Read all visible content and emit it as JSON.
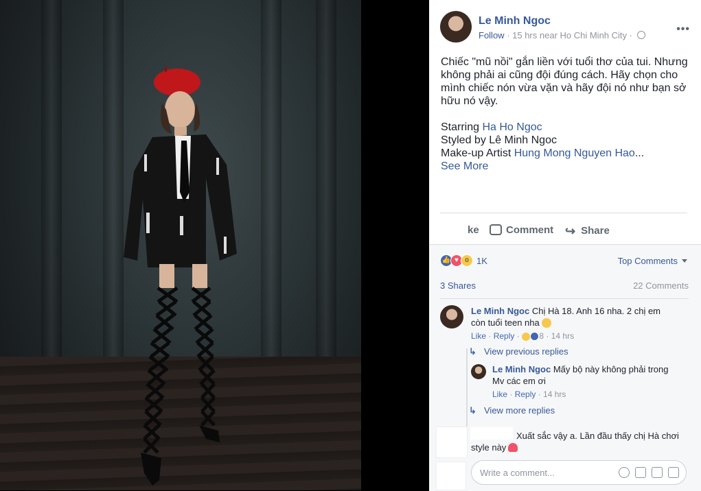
{
  "post": {
    "author": "Le Minh Ngoc",
    "follow_label": "Follow",
    "meta": " · 15 hrs near Ho Chi Minh City · ",
    "more_label": "•••",
    "text_line1": "Chiếc \"mũ nồi\" gắn liền với tuổi thơ của tui. Nhưng không phải ai cũng đội đúng cách. Hãy chọn cho mình chiếc nón vừa vặn và hãy đội nó như bạn sở hữu nó vậy.",
    "starring_prefix": "Starring ",
    "starring_name": "Ha Ho Ngoc",
    "styled_by": "Styled by Lê Minh Ngoc",
    "makeup_prefix": "Make-up Artist ",
    "makeup_name": "Hung Mong Nguyen Hao",
    "ellipsis": "...",
    "see_more": "See More"
  },
  "actions": {
    "like_partial": "ke",
    "comment_label": "Comment",
    "share_label": "Share"
  },
  "reactions": {
    "count": "1K",
    "top_comments": "Top Comments",
    "shares": "3 Shares",
    "comments": "22 Comments"
  },
  "comments": [
    {
      "author": "Le Minh Ngoc",
      "text": " Chị Hà 18. Anh 16 nha. 2 chị em còn tuổi teen nha",
      "like": "Like",
      "reply": "Reply",
      "reactions_count": "8",
      "time": "14 hrs"
    },
    {
      "author": "Le Minh Ngoc",
      "text": " Mấy bộ này không phải trong Mv các em ơi",
      "like": "Like",
      "reply": "Reply",
      "time": "14 hrs"
    },
    {
      "text": "Xuất sắc vậy a. Lần đầu thấy chị Hà chơi style này"
    }
  ],
  "replies": {
    "view_previous": "View previous replies",
    "view_more": "View more replies"
  },
  "composer": {
    "placeholder": "Write a comment..."
  }
}
